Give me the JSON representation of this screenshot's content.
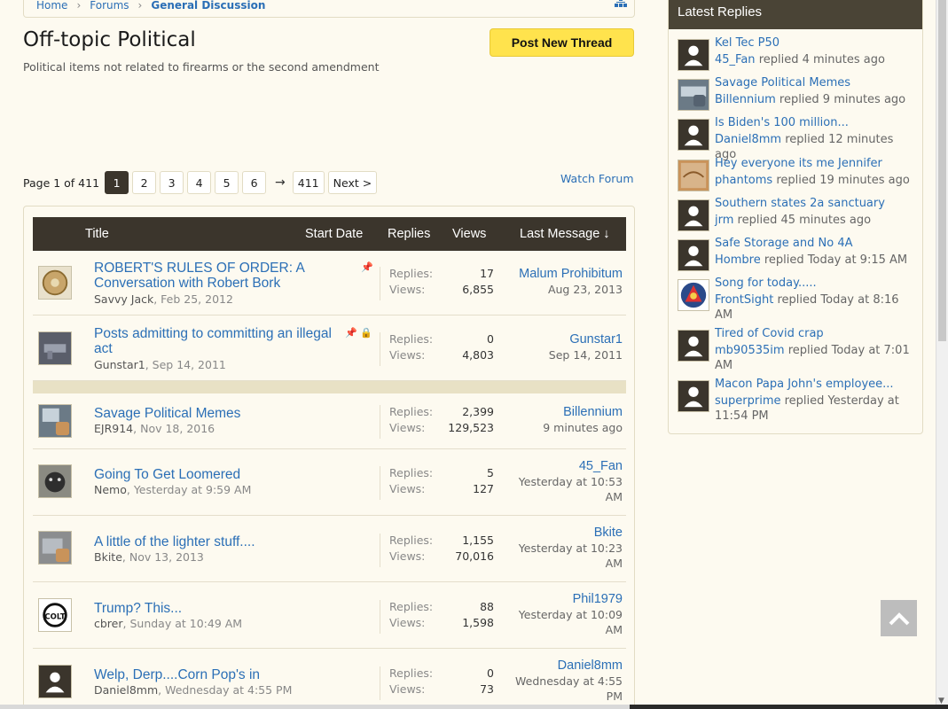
{
  "breadcrumb": {
    "items": [
      "Home",
      "Forums",
      "General Discussion"
    ],
    "sep": "›"
  },
  "forum": {
    "title": "Off-topic Political",
    "description": "Political items not related to firearms or the second amendment",
    "post_button": "Post New Thread",
    "watch": "Watch Forum"
  },
  "pagination": {
    "label": "Page 1 of 411",
    "pages": [
      "1",
      "2",
      "3",
      "4",
      "5",
      "6"
    ],
    "arrow": "→",
    "last": "411",
    "next": "Next >"
  },
  "table": {
    "headers": {
      "title": "Title",
      "start": "Start Date",
      "replies": "Replies",
      "views": "Views",
      "last": "Last Message ↓"
    },
    "labels": {
      "replies": "Replies:",
      "views": "Views:"
    }
  },
  "threads": [
    {
      "title": "ROBERT'S RULES OF ORDER: A Conversation with Robert Bork",
      "author": "Savvy Jack",
      "date": "Feb 25, 2012",
      "replies": "17",
      "views": "6,855",
      "last_user": "Malum Prohibitum",
      "last_date": "Aug 23, 2013",
      "icons": "📌"
    },
    {
      "title": "Posts admitting to committing an illegal act",
      "author": "Gunstar1",
      "date": "Sep 14, 2011",
      "replies": "0",
      "views": "4,803",
      "last_user": "Gunstar1",
      "last_date": "Sep 14, 2011",
      "icons": "📌 🔒"
    },
    {
      "title": "Savage Political Memes",
      "author": "EJR914",
      "date": "Nov 18, 2016",
      "replies": "2,399",
      "views": "129,523",
      "last_user": "Billennium",
      "last_date": "9 minutes ago"
    },
    {
      "title": "Going To Get Loomered",
      "author": "Nemo",
      "date": "Yesterday at 9:59 AM",
      "replies": "5",
      "views": "127",
      "last_user": "45_Fan",
      "last_date": "Yesterday at 10:53 AM"
    },
    {
      "title": "A little of the lighter stuff....",
      "author": "Bkite",
      "date": "Nov 13, 2013",
      "replies": "1,155",
      "views": "70,016",
      "last_user": "Bkite",
      "last_date": "Yesterday at 10:23 AM"
    },
    {
      "title": "Trump? This...",
      "author": "cbrer",
      "date": "Sunday at 10:49 AM",
      "replies": "88",
      "views": "1,598",
      "last_user": "Phil1979",
      "last_date": "Yesterday at 10:09 AM"
    },
    {
      "title": "Welp, Derp....Corn Pop's in",
      "author": "Daniel8mm",
      "date": "Wednesday at 4:55 PM",
      "replies": "0",
      "views": "73",
      "last_user": "Daniel8mm",
      "last_date": "Wednesday at 4:55 PM"
    }
  ],
  "sidebar": {
    "title": "Latest Replies",
    "items": [
      {
        "title": "Kel Tec P50",
        "user": "45_Fan",
        "when": "replied 4 minutes ago"
      },
      {
        "title": "Savage Political Memes",
        "user": "Billennium",
        "when": "replied 9 minutes ago"
      },
      {
        "title": "Is Biden's 100 million...",
        "user": "Daniel8mm",
        "when": "replied 12 minutes ago"
      },
      {
        "title": "Hey everyone its me Jennifer",
        "user": "phantoms",
        "when": "replied 19 minutes ago"
      },
      {
        "title": "Southern states 2a sanctuary",
        "user": "jrm",
        "when": "replied 45 minutes ago"
      },
      {
        "title": "Safe Storage and No 4A",
        "user": "Hombre",
        "when": "replied Today at 9:15 AM"
      },
      {
        "title": "Song for today.....",
        "user": "FrontSight",
        "when": "replied Today at 8:16 AM"
      },
      {
        "title": "Tired of Covid crap",
        "user": "mb90535im",
        "when": "replied Today at 7:01 AM"
      },
      {
        "title": "Macon Papa John's employee...",
        "user": "superprime",
        "when": "replied Yesterday at 11:54 PM"
      }
    ]
  },
  "colors": {
    "accent": "#2b6fb6",
    "header_bg": "#3b352c",
    "button": "#ffe34d",
    "page_bg": "#fdfaf0"
  }
}
